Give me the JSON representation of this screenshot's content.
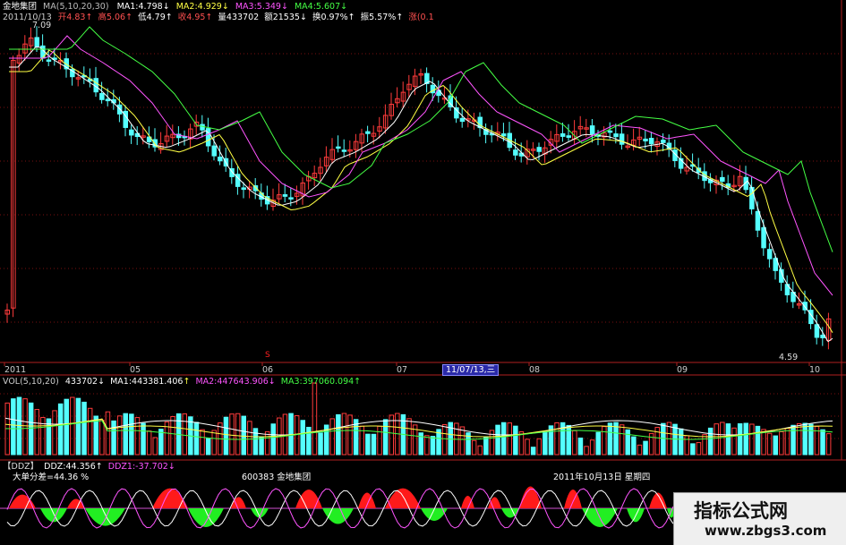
{
  "header": {
    "stock_name": "金地集团",
    "ma_set": "MA(5,10,20,30)",
    "ma1": "MA1:4.798",
    "ma2": "MA2:4.929",
    "ma3": "MA3:5.349",
    "ma4": "MA4:5.607",
    "date": "2011/10/13",
    "open": "开4.83",
    "high": "高5.06",
    "low": "低4.79",
    "close": "收4.95",
    "volume": "量433702",
    "amount": "额21535",
    "turnover": "换0.97%",
    "amplitude": "振5.57%",
    "change": "涨(0.1"
  },
  "price_panel": {
    "peak_label": "7.09",
    "low_label": "4.59",
    "split_marker": "S"
  },
  "time_axis": {
    "labels": [
      "2011",
      "05",
      "06",
      "07",
      "08",
      "09",
      "10"
    ],
    "cursor_label": "11/07/13,三"
  },
  "volume_panel": {
    "title": "VOL(5,10,20)",
    "value": "433702",
    "ma1": "MA1:443381.406",
    "ma2": "MA2:447643.906",
    "ma3": "MA3:397060.094"
  },
  "ddz_panel": {
    "tag": "【DDZ】",
    "ddz": "DDZ:44.356",
    "ddz1": "DDZ1:-37.702",
    "big_order": "大单分差=44.36 %",
    "code_name": "600383  金地集团",
    "date_text": "2011年10月13日  星期四"
  },
  "watermark": {
    "title": "指标公式网",
    "url": "www.zbgs3.com"
  },
  "colors": {
    "up": "#ff3b3b",
    "down": "#54ffff",
    "ma1": "#ffffff",
    "ma2": "#ffff44",
    "ma3": "#ff55ff",
    "ma4": "#44ff44",
    "ddz_pos": "#ff1a1a",
    "ddz_neg": "#22ee22"
  }
}
